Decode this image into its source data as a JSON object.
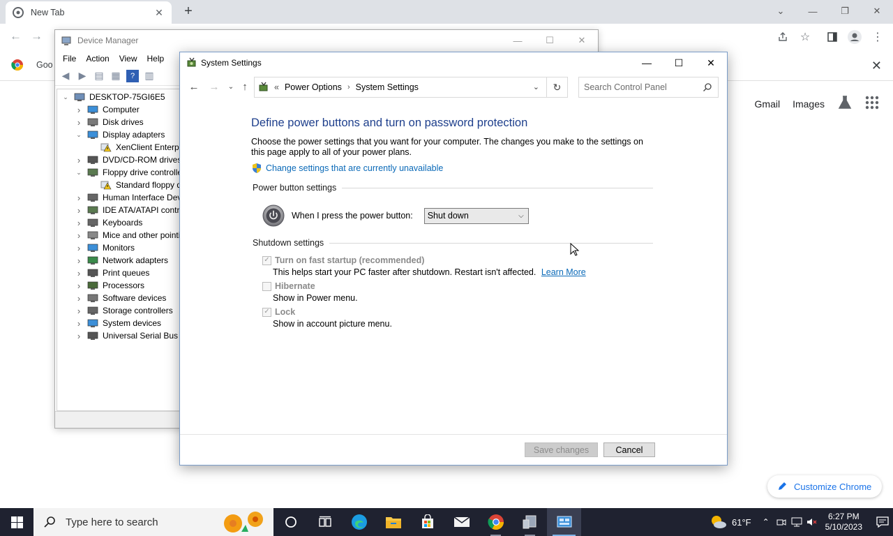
{
  "chrome": {
    "tab_title": "New Tab",
    "bookmark_label": "Goo",
    "links": [
      "Gmail",
      "Images"
    ],
    "customize_label": "Customize Chrome"
  },
  "device_manager": {
    "title": "Device Manager",
    "menu": [
      "File",
      "Action",
      "View",
      "Help"
    ],
    "tree": [
      {
        "label": "DESKTOP-75GI6E5",
        "level": 0,
        "expand": "open",
        "icon": "computer"
      },
      {
        "label": "Computer",
        "level": 1,
        "expand": "closed",
        "icon": "monitor"
      },
      {
        "label": "Disk drives",
        "level": 1,
        "expand": "closed",
        "icon": "disk"
      },
      {
        "label": "Display adapters",
        "level": 1,
        "expand": "open",
        "icon": "display"
      },
      {
        "label": "XenClient Enterpri",
        "level": 2,
        "expand": "none",
        "icon": "warning"
      },
      {
        "label": "DVD/CD-ROM drives",
        "level": 1,
        "expand": "closed",
        "icon": "dvd"
      },
      {
        "label": "Floppy drive controlle",
        "level": 1,
        "expand": "open",
        "icon": "controller"
      },
      {
        "label": "Standard floppy di",
        "level": 2,
        "expand": "none",
        "icon": "warning"
      },
      {
        "label": "Human Interface Devi",
        "level": 1,
        "expand": "closed",
        "icon": "hid"
      },
      {
        "label": "IDE ATA/ATAPI contro",
        "level": 1,
        "expand": "closed",
        "icon": "controller"
      },
      {
        "label": "Keyboards",
        "level": 1,
        "expand": "closed",
        "icon": "keyboard"
      },
      {
        "label": "Mice and other pointi",
        "level": 1,
        "expand": "closed",
        "icon": "mouse"
      },
      {
        "label": "Monitors",
        "level": 1,
        "expand": "closed",
        "icon": "monitor"
      },
      {
        "label": "Network adapters",
        "level": 1,
        "expand": "closed",
        "icon": "network"
      },
      {
        "label": "Print queues",
        "level": 1,
        "expand": "closed",
        "icon": "printer"
      },
      {
        "label": "Processors",
        "level": 1,
        "expand": "closed",
        "icon": "cpu"
      },
      {
        "label": "Software devices",
        "level": 1,
        "expand": "closed",
        "icon": "software"
      },
      {
        "label": "Storage controllers",
        "level": 1,
        "expand": "closed",
        "icon": "storage"
      },
      {
        "label": "System devices",
        "level": 1,
        "expand": "closed",
        "icon": "system"
      },
      {
        "label": "Universal Serial Bus co",
        "level": 1,
        "expand": "closed",
        "icon": "usb"
      }
    ]
  },
  "system_settings": {
    "title": "System Settings",
    "breadcrumb": [
      "Power Options",
      "System Settings"
    ],
    "breadcrumb_prefix": "«",
    "search_placeholder": "Search Control Panel",
    "heading": "Define power buttons and turn on password protection",
    "description": "Choose the power settings that you want for your computer. The changes you make to the settings on this page apply to all of your power plans.",
    "change_link": "Change settings that are currently unavailable",
    "power_section": "Power button settings",
    "power_label": "When I press the power button:",
    "power_value": "Shut down",
    "shutdown_section": "Shutdown settings",
    "options": [
      {
        "label": "Turn on fast startup (recommended)",
        "desc": "This helps start your PC faster after shutdown. Restart isn't affected.",
        "link": "Learn More",
        "checked": true
      },
      {
        "label": "Hibernate",
        "desc": "Show in Power menu.",
        "link": "",
        "checked": false
      },
      {
        "label": "Lock",
        "desc": "Show in account picture menu.",
        "link": "",
        "checked": true
      }
    ],
    "save_label": "Save changes",
    "cancel_label": "Cancel"
  },
  "taskbar": {
    "search_placeholder": "Type here to search",
    "temperature": "61°F",
    "time": "6:27 PM",
    "date": "5/10/2023"
  },
  "colors": {
    "heading_blue": "#1e3f8c",
    "link_blue": "#0b6ab8",
    "taskbar_bg": "#1f2230"
  }
}
